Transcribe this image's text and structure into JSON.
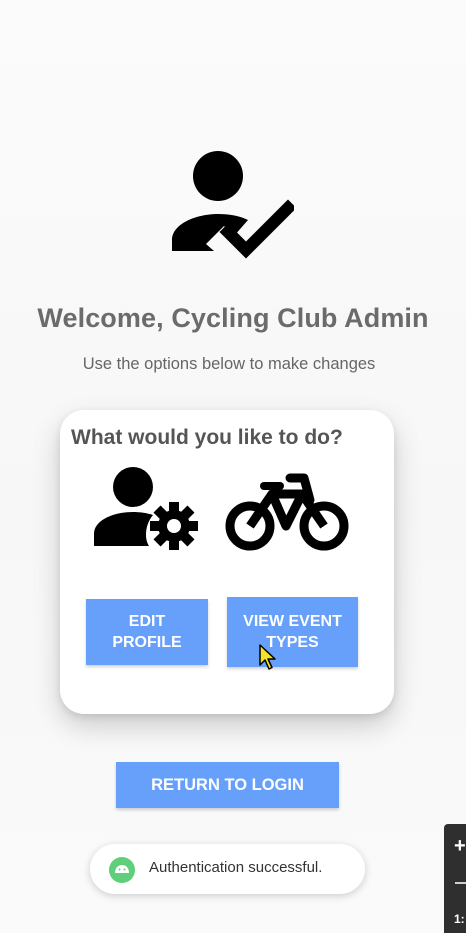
{
  "header": {
    "title": "Welcome, Cycling Club Admin",
    "subtitle": "Use the options below to make changes",
    "icon": "person-check-icon"
  },
  "card": {
    "question": "What would you like to do?",
    "admin_icon": "person-gear-icon",
    "bike_icon": "bicycle-icon",
    "edit_profile_label": "EDIT\nPROFILE",
    "view_event_types_label": "VIEW EVENT\nTYPES"
  },
  "actions": {
    "return_to_login_label": "RETURN TO LOGIN"
  },
  "toast": {
    "message": "Authentication successful.",
    "icon": "android-icon",
    "icon_color": "#5fcf7b"
  },
  "side_panel": {
    "plus": "+",
    "number": "1:"
  },
  "colors": {
    "button": "#66a0fb",
    "title": "#6b6b6b",
    "background": "#fafafa"
  }
}
